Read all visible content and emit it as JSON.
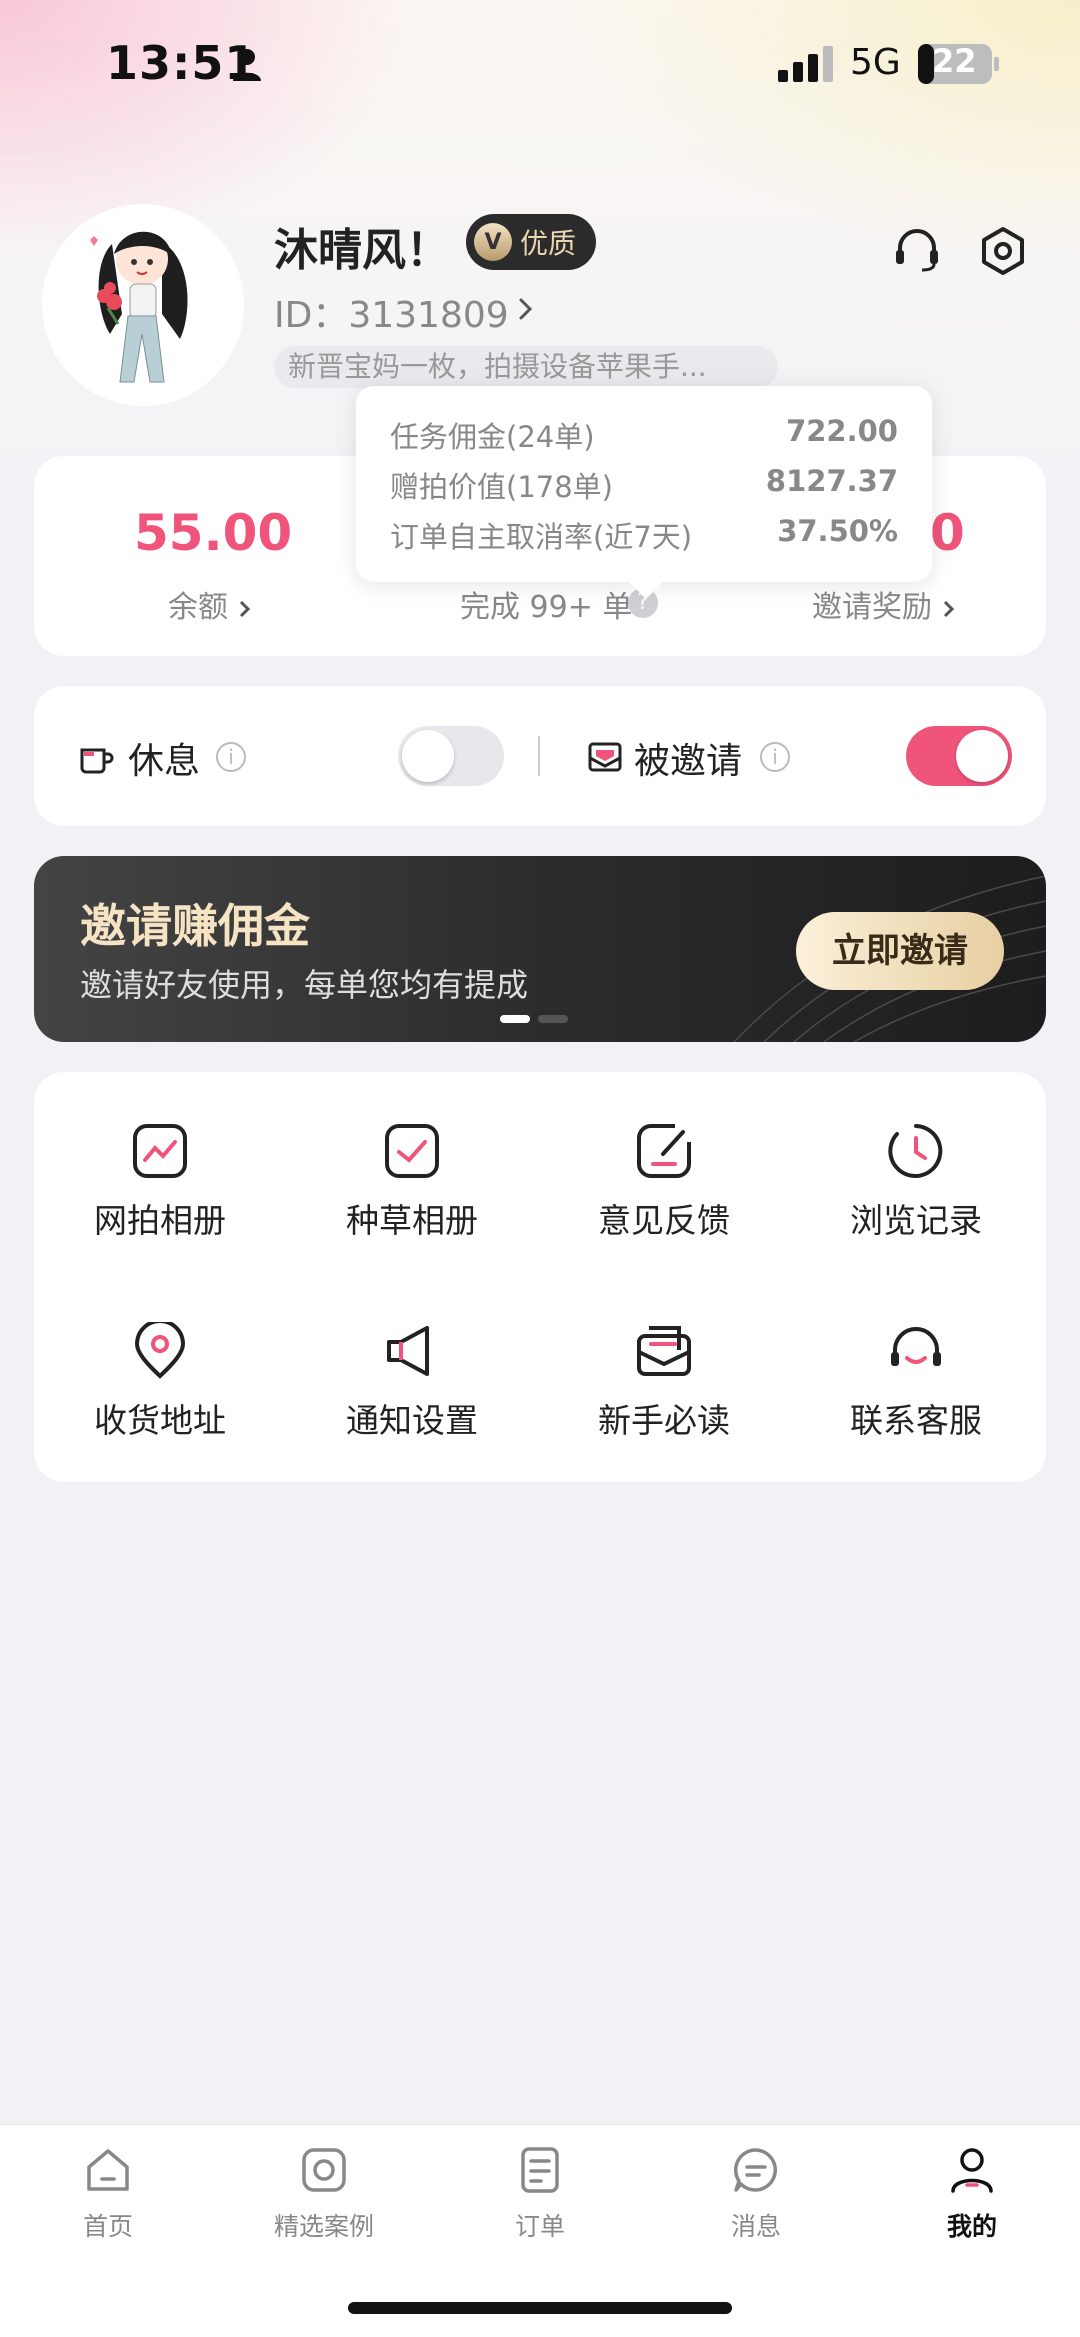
{
  "status_bar": {
    "time": "13:51",
    "network": "5G",
    "battery": "22"
  },
  "profile": {
    "nickname": "沐晴风！",
    "badge": "优质",
    "badge_letter": "V",
    "user_id": "ID：3131809",
    "bio": "新晋宝妈一枚，拍摄设备苹果手..."
  },
  "stats": {
    "balance_value": "55.00",
    "balance_label": "余额",
    "completed_label": "完成 99+ 单",
    "invite_value": "0",
    "invite_label": "邀请奖励",
    "help_mark": "?"
  },
  "tooltip": {
    "rows": [
      {
        "label": "任务佣金(24单)",
        "value": "722.00"
      },
      {
        "label": "赠拍价值(178单)",
        "value": "8127.37"
      },
      {
        "label": "订单自主取消率(近7天)",
        "value": "37.50%"
      }
    ]
  },
  "toggles": {
    "rest_label": "休息",
    "rest_on": false,
    "invited_label": "被邀请",
    "invited_on": true,
    "info_mark": "i"
  },
  "banner": {
    "title": "邀请赚佣金",
    "subtitle": "邀请好友使用，每单您均有提成",
    "button": "立即邀请"
  },
  "menu": [
    {
      "label": "网拍相册",
      "icon": "photo-album-icon"
    },
    {
      "label": "种草相册",
      "icon": "check-album-icon"
    },
    {
      "label": "意见反馈",
      "icon": "feedback-icon"
    },
    {
      "label": "浏览记录",
      "icon": "history-icon"
    },
    {
      "label": "收货地址",
      "icon": "location-icon"
    },
    {
      "label": "通知设置",
      "icon": "megaphone-icon"
    },
    {
      "label": "新手必读",
      "icon": "mail-guide-icon"
    },
    {
      "label": "联系客服",
      "icon": "customer-service-icon"
    }
  ],
  "tabs": [
    {
      "label": "首页",
      "icon": "home-icon"
    },
    {
      "label": "精选案例",
      "icon": "camera-icon"
    },
    {
      "label": "订单",
      "icon": "order-icon"
    },
    {
      "label": "消息",
      "icon": "message-icon"
    },
    {
      "label": "我的",
      "icon": "profile-icon",
      "active": true
    }
  ],
  "colors": {
    "accent": "#f0547a",
    "toggle_on": "#f0547a",
    "toggle_off": "#e8e8ec",
    "banner_gold": "#f5e3c4"
  }
}
